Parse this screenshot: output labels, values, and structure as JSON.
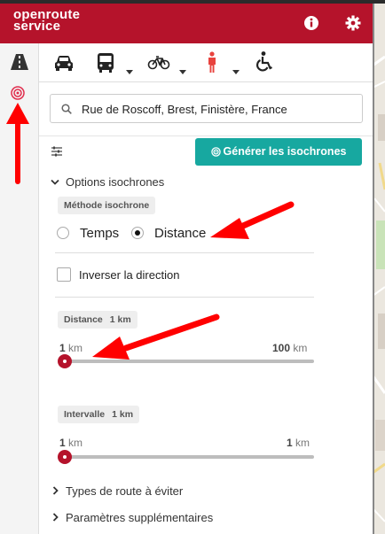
{
  "header": {
    "logo_line1": "openroute",
    "logo_line2": "service",
    "brand_color": "#b5132b"
  },
  "sidebar": {
    "items": [
      {
        "icon": "directions-icon",
        "active": false
      },
      {
        "icon": "isochrones-icon",
        "active": true
      }
    ]
  },
  "profiles": [
    "car-icon",
    "bus-icon",
    "bicycle-icon",
    "pedestrian-icon",
    "wheelchair-icon"
  ],
  "search": {
    "value": "Rue de Roscoff, Brest, Finistère, France"
  },
  "generate_button": {
    "label": "Générer les isochrones",
    "color": "#17a8a0"
  },
  "options": {
    "title": "Options isochrones",
    "method_chip": "Méthode isochrone",
    "method_options": [
      "Temps",
      "Distance"
    ],
    "method_selected": "Distance",
    "invert_label": "Inverser la direction",
    "invert_checked": false,
    "distance": {
      "label": "Distance",
      "value": "1 km",
      "min": "1",
      "max": "100",
      "unit": "km",
      "level": 0
    },
    "interval": {
      "label": "Intervalle",
      "value": "1 km",
      "min": "1",
      "max": "1",
      "unit": "km",
      "level": 0
    }
  },
  "collapsibles": [
    "Types de route à éviter",
    "Paramètres supplémentaires"
  ],
  "annotation_color": "#ff0000"
}
